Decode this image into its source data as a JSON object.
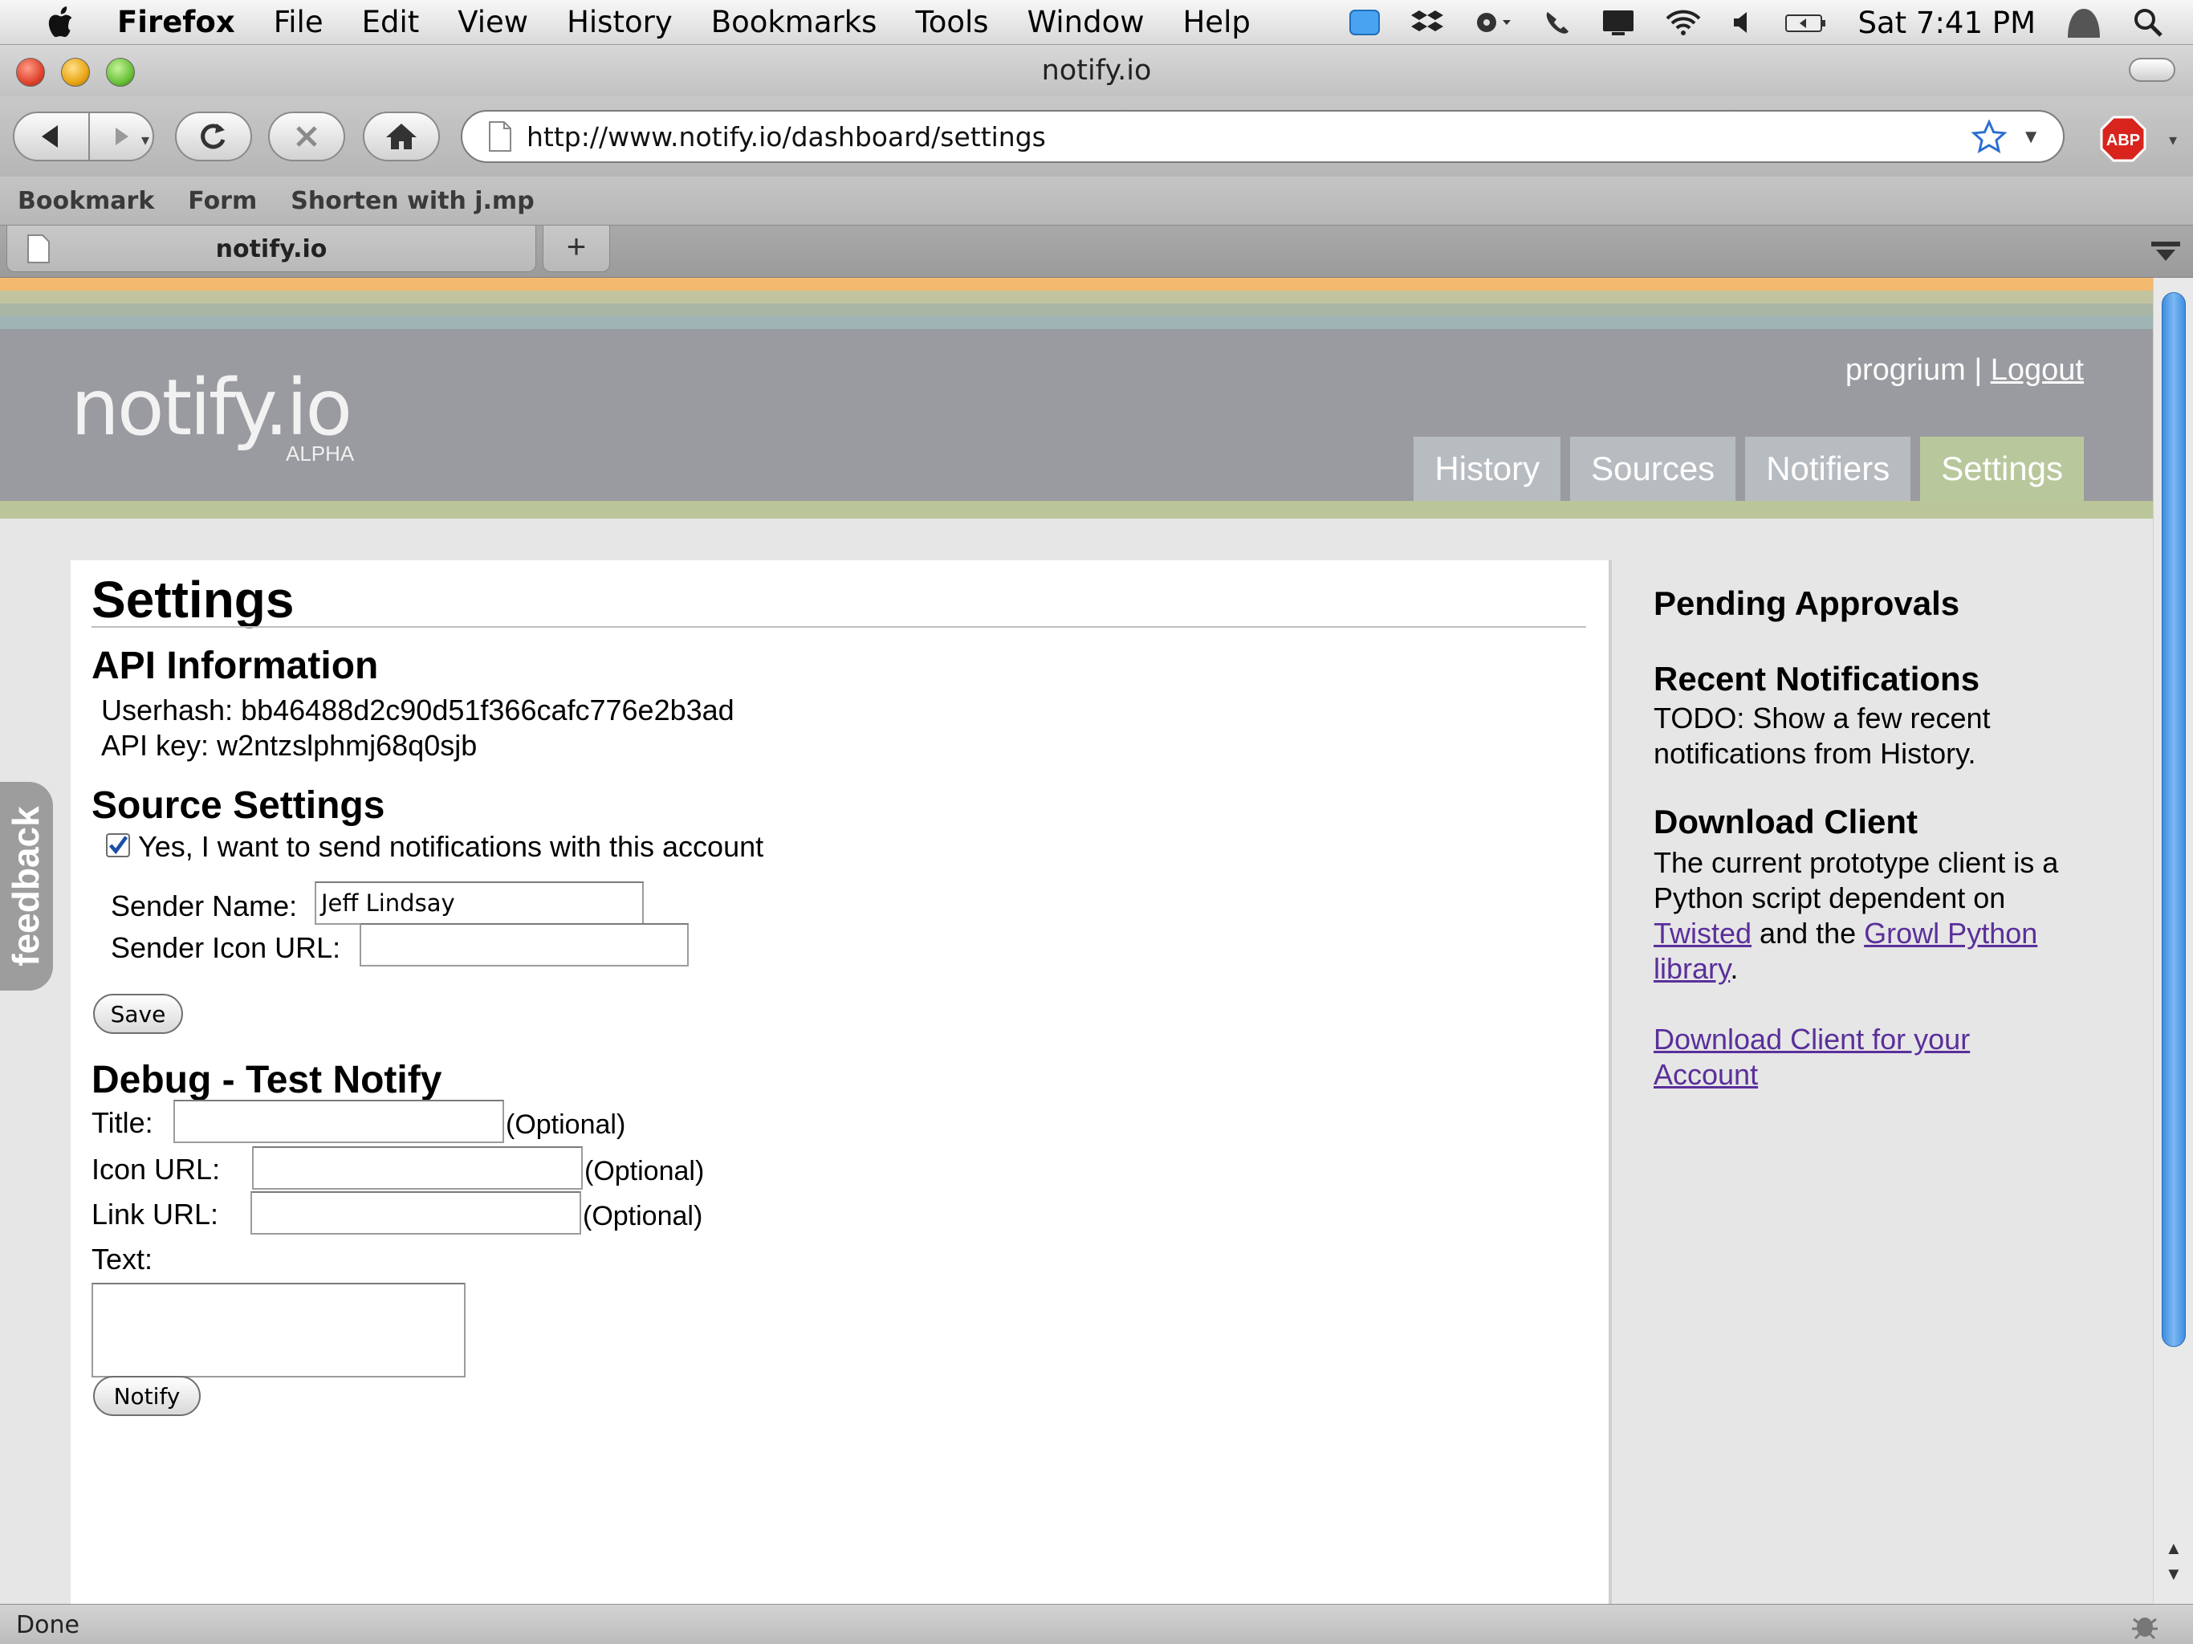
{
  "menubar": {
    "app_name": "Firefox",
    "menus": [
      "File",
      "Edit",
      "View",
      "History",
      "Bookmarks",
      "Tools",
      "Window",
      "Help"
    ],
    "clock": "Sat 7:41 PM",
    "status_icons": [
      "growl-icon",
      "dropbox-icon",
      "gear-icon",
      "phone-icon",
      "display-icon",
      "wifi-icon",
      "volume-icon",
      "battery-icon",
      "user-icon",
      "spotlight-icon"
    ]
  },
  "window": {
    "title": "notify.io"
  },
  "navbar": {
    "url": "http://www.notify.io/dashboard/settings"
  },
  "bookmarks": [
    "Bookmark",
    "Form",
    "Shorten with j.mp"
  ],
  "tabs": {
    "active_label": "notify.io",
    "new_tab_label": "+"
  },
  "site": {
    "logo": "notify.io",
    "logo_sub": "ALPHA",
    "username": "progrium",
    "separator": "|",
    "logout": "Logout",
    "nav": [
      "History",
      "Sources",
      "Notifiers",
      "Settings"
    ],
    "active_nav": "Settings",
    "stripe_colors": [
      "#f2b96f",
      "#c2c4a0",
      "#a9b6a5",
      "#9fb4b4"
    ]
  },
  "main": {
    "title": "Settings",
    "api": {
      "heading": "API Information",
      "userhash_label": "Userhash:",
      "userhash_value": "bb46488d2c90d51f366cafc776e2b3ad",
      "apikey_label": "API key:",
      "apikey_value": "w2ntzslphmj68q0sjb"
    },
    "source": {
      "heading": "Source Settings",
      "checkbox_label": "Yes, I want to send notifications with this account",
      "checked": true,
      "sender_name_label": "Sender Name:",
      "sender_name_value": "Jeff Lindsay",
      "sender_icon_label": "Sender Icon URL:",
      "sender_icon_value": "",
      "save_label": "Save"
    },
    "debug": {
      "heading": "Debug - Test Notify",
      "title_label": "Title:",
      "icon_label": "Icon URL:",
      "link_label": "Link URL:",
      "text_label": "Text:",
      "optional": "(Optional)",
      "notify_label": "Notify"
    }
  },
  "sidebar": {
    "pending_heading": "Pending Approvals",
    "recent_heading": "Recent Notifications",
    "recent_line1": "TODO: Show a few recent",
    "recent_line2": "notifications from History.",
    "download_heading": "Download Client",
    "download_line1": "The current prototype client is a",
    "download_line2": "Python script dependent on",
    "twisted_link": "Twisted",
    "and_the": " and the ",
    "growl_link_1": "Growl Python",
    "growl_link_2": "library",
    "period": ".",
    "download_link_1": "Download Client for your",
    "download_link_2": "Account"
  },
  "feedback": {
    "label": "feedback"
  },
  "statusbar": {
    "text": "Done"
  }
}
